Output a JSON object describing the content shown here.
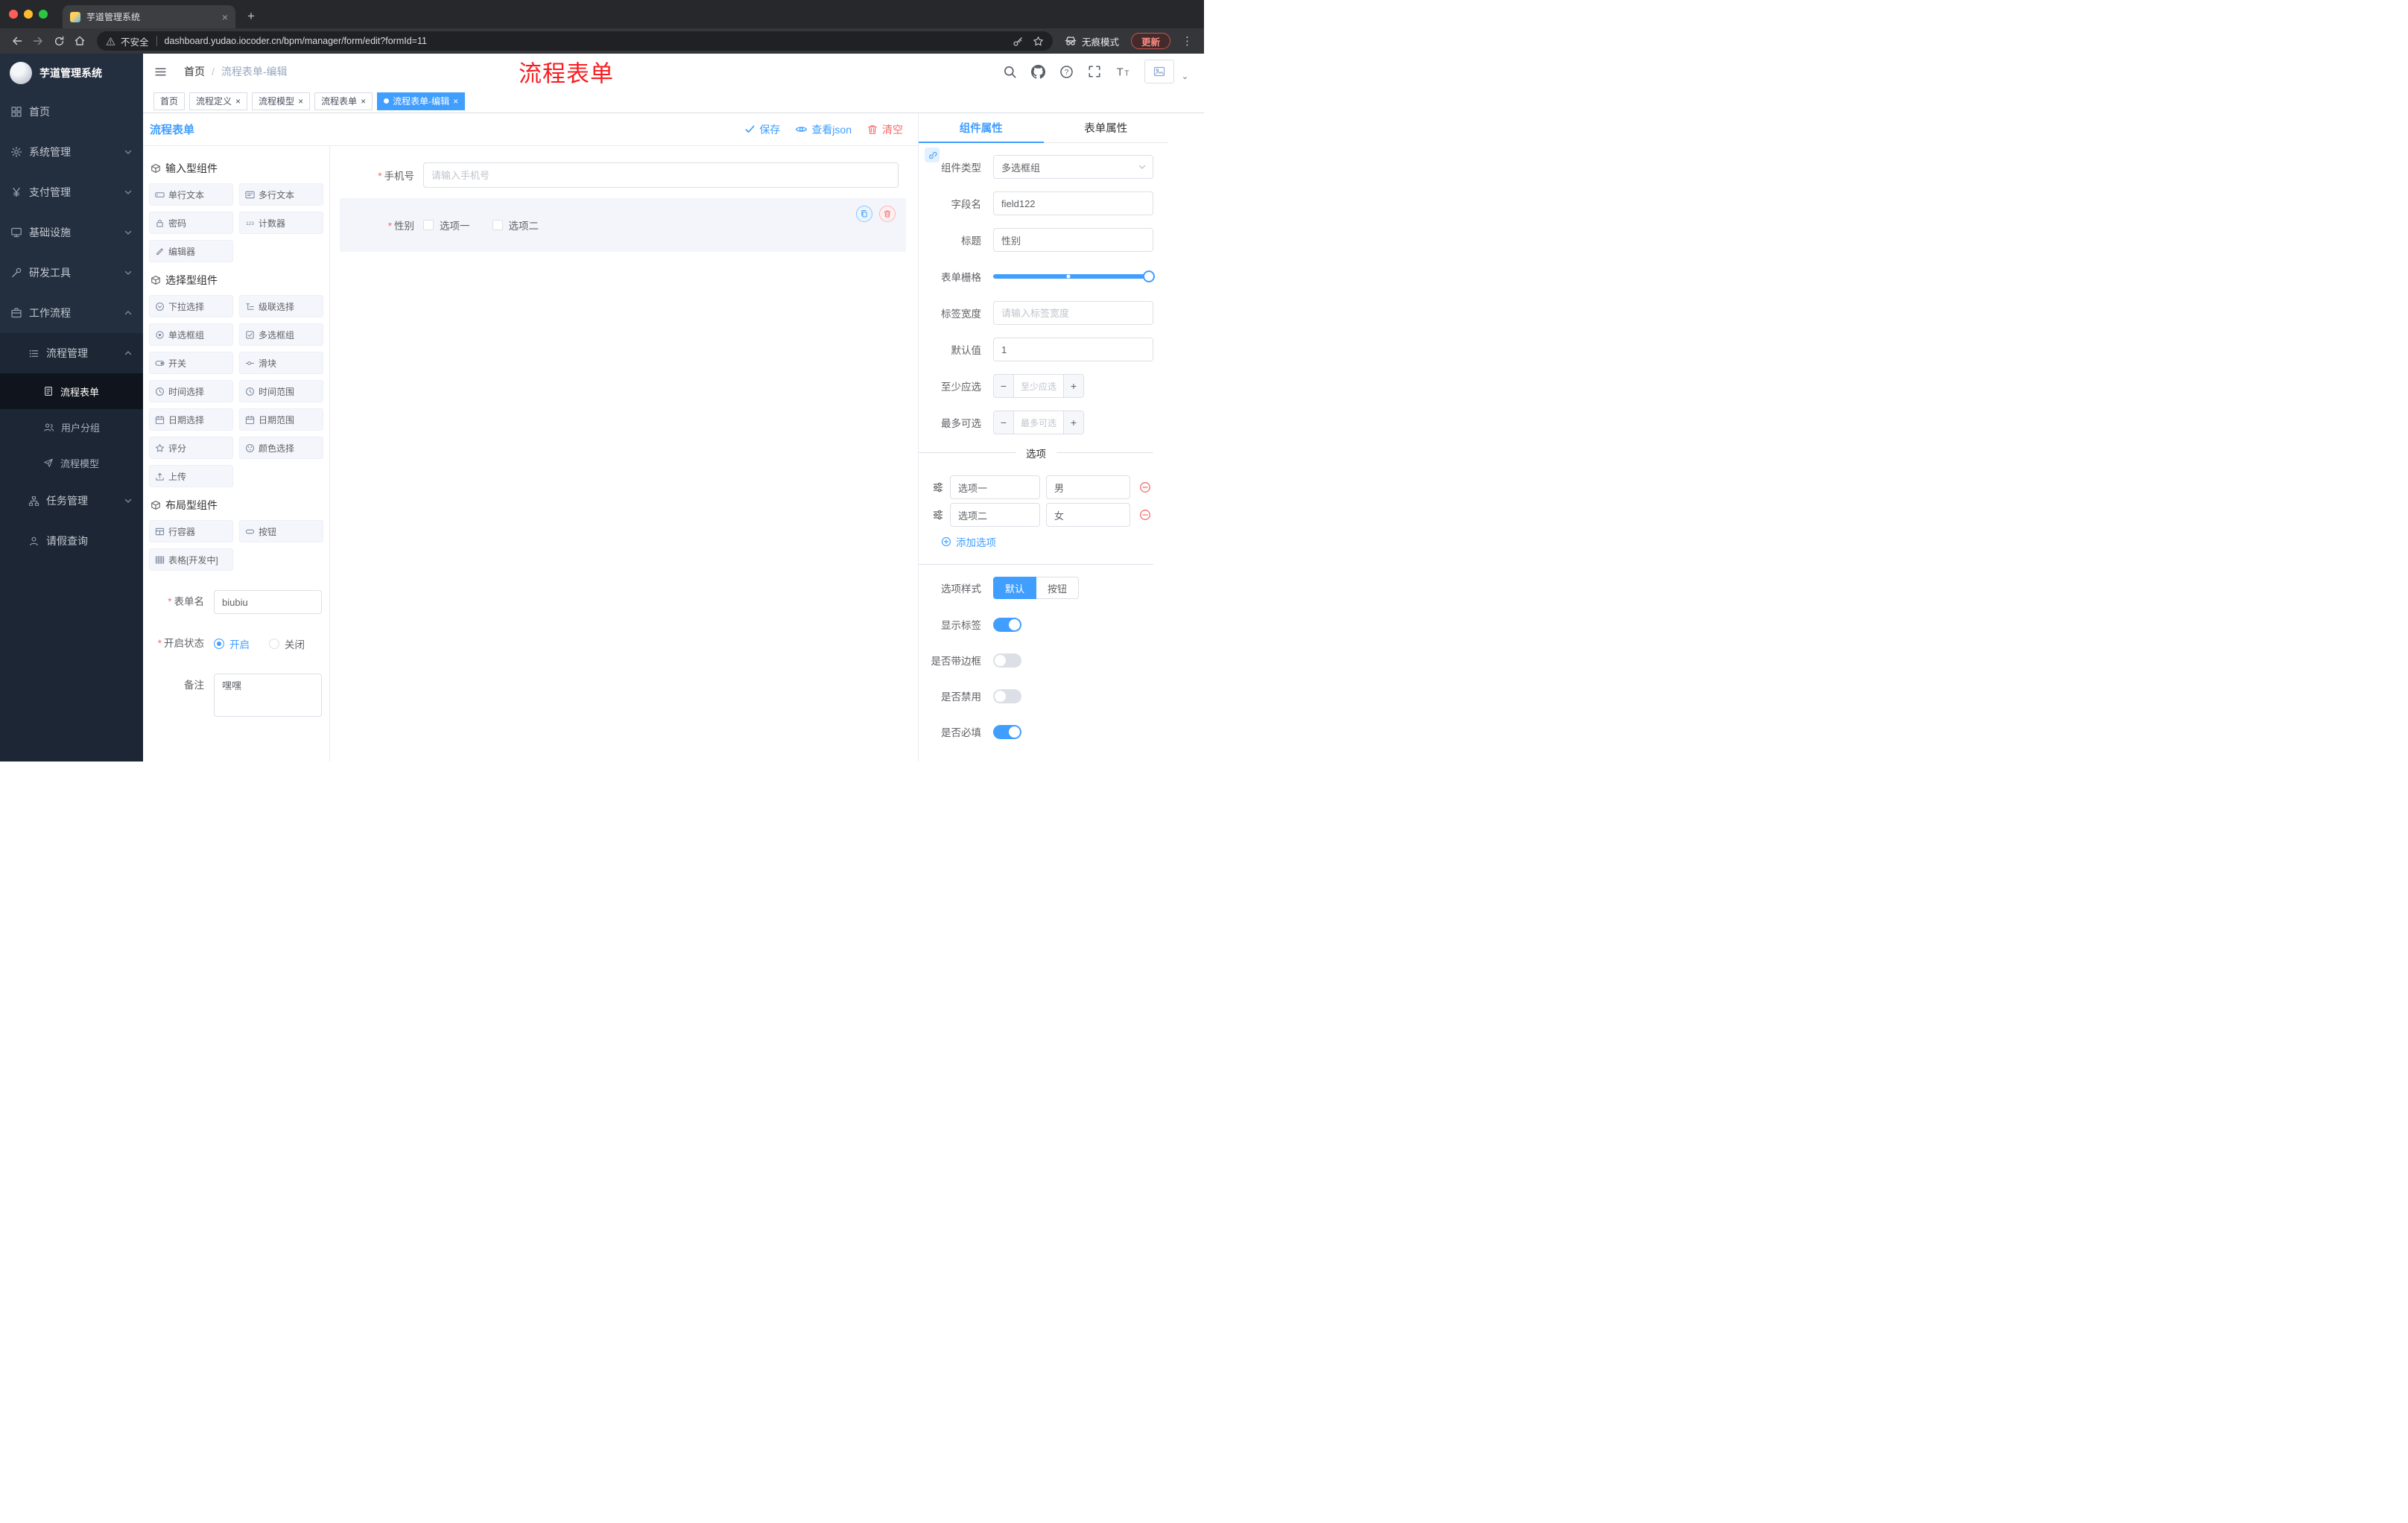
{
  "colors": {
    "primary": "#409eff",
    "danger": "#f56c6c",
    "annotation": "#f81d22",
    "sidebar_bg": "#1a212e"
  },
  "annotation": {
    "title": "流程表单"
  },
  "browser": {
    "tab_title": "芋道管理系统",
    "security": "不安全",
    "url": "dashboard.yudao.iocoder.cn/bpm/manager/form/edit?formId=11",
    "incognito": "无痕模式",
    "update": "更新"
  },
  "sidebar": {
    "title": "芋道管理系统",
    "menu": [
      {
        "label": "首页",
        "icon": "home-icon",
        "active": false
      },
      {
        "label": "系统管理",
        "icon": "gear-icon",
        "active": false
      },
      {
        "label": "支付管理",
        "icon": "yen-icon",
        "active": false
      },
      {
        "label": "基础设施",
        "icon": "monitor-icon",
        "active": false
      },
      {
        "label": "研发工具",
        "icon": "tools-icon",
        "active": false
      },
      {
        "label": "工作流程",
        "icon": "briefcase-icon",
        "active": false
      },
      {
        "label": "流程管理",
        "icon": "list-icon",
        "active": false
      },
      {
        "label": "流程表单",
        "icon": "document-icon",
        "active": true
      },
      {
        "label": "用户分组",
        "icon": "users-icon",
        "active": false
      },
      {
        "label": "流程模型",
        "icon": "paper-plane-icon",
        "active": false
      },
      {
        "label": "任务管理",
        "icon": "tree-icon",
        "active": false
      },
      {
        "label": "请假查询",
        "icon": "user-icon",
        "active": false
      }
    ]
  },
  "header": {
    "breadcrumb_home": "首页",
    "breadcrumb_sep": "/",
    "breadcrumb_current": "流程表单-编辑"
  },
  "tags": [
    {
      "label": "首页",
      "closable": false,
      "active": false
    },
    {
      "label": "流程定义",
      "closable": true,
      "active": false
    },
    {
      "label": "流程模型",
      "closable": true,
      "active": false
    },
    {
      "label": "流程表单",
      "closable": true,
      "active": false
    },
    {
      "label": "流程表单-编辑",
      "closable": true,
      "active": true
    }
  ],
  "designer": {
    "title": "流程表单",
    "actions": {
      "save": "保存",
      "view_json": "查看json",
      "clear": "清空"
    },
    "groups": [
      {
        "title": "输入型组件",
        "items": [
          {
            "label": "单行文本",
            "icon": "input-icon"
          },
          {
            "label": "多行文本",
            "icon": "textarea-icon"
          },
          {
            "label": "密码",
            "icon": "lock-icon"
          },
          {
            "label": "计数器",
            "icon": "counter-icon"
          },
          {
            "label": "编辑器",
            "icon": "editor-icon"
          }
        ]
      },
      {
        "title": "选择型组件",
        "items": [
          {
            "label": "下拉选择",
            "icon": "select-icon"
          },
          {
            "label": "级联选择",
            "icon": "cascader-icon"
          },
          {
            "label": "单选框组",
            "icon": "radio-icon"
          },
          {
            "label": "多选框组",
            "icon": "checkbox-icon"
          },
          {
            "label": "开关",
            "icon": "switch-icon"
          },
          {
            "label": "滑块",
            "icon": "slider-icon"
          },
          {
            "label": "时间选择",
            "icon": "clock-icon"
          },
          {
            "label": "时间范围",
            "icon": "clock-icon"
          },
          {
            "label": "日期选择",
            "icon": "calendar-icon"
          },
          {
            "label": "日期范围",
            "icon": "calendar-icon"
          },
          {
            "label": "评分",
            "icon": "star-icon"
          },
          {
            "label": "颜色选择",
            "icon": "color-icon"
          },
          {
            "label": "上传",
            "icon": "upload-icon"
          }
        ]
      },
      {
        "title": "布局型组件",
        "items": [
          {
            "label": "行容器",
            "icon": "row-icon"
          },
          {
            "label": "按钮",
            "icon": "button-icon"
          },
          {
            "label": "表格[开发中]",
            "icon": "table-icon"
          }
        ]
      }
    ],
    "meta": {
      "name_label": "表单名",
      "name_value": "biubiu",
      "status_label": "开启状态",
      "status_on": "开启",
      "status_off": "关闭",
      "status_on_checked": true,
      "status_off_checked": false,
      "remark_label": "备注",
      "remark_value": "嘿嘿"
    },
    "canvas": {
      "phone_label": "手机号",
      "phone_placeholder": "请输入手机号",
      "gender_label": "性别",
      "gender_options": [
        {
          "label": "选项一",
          "checked": false
        },
        {
          "label": "选项二",
          "checked": false
        }
      ]
    }
  },
  "props": {
    "tab_component": "组件属性",
    "tab_form": "表单属性",
    "rows": {
      "type_label": "组件类型",
      "type_value": "多选框组",
      "field_label": "字段名",
      "field_value": "field122",
      "title_label": "标题",
      "title_value": "性别",
      "grid_label": "表单栅格",
      "labelw_label": "标签宽度",
      "labelw_placeholder": "请输入标签宽度",
      "default_label": "默认值",
      "default_value": "1",
      "min_label": "至少应选",
      "min_placeholder": "至少应选",
      "max_label": "最多可选",
      "max_placeholder": "最多可选"
    },
    "options": {
      "divider": "选项",
      "rows": [
        {
          "name": "选项一",
          "value": "男"
        },
        {
          "name": "选项二",
          "value": "女"
        }
      ],
      "add": "添加选项"
    },
    "style": {
      "label": "选项样式",
      "options": [
        {
          "label": "默认",
          "active": true
        },
        {
          "label": "按钮",
          "active": false
        }
      ]
    },
    "switches": [
      {
        "label": "显示标签",
        "on": true
      },
      {
        "label": "是否带边框",
        "on": false
      },
      {
        "label": "是否禁用",
        "on": false
      },
      {
        "label": "是否必填",
        "on": true
      }
    ]
  }
}
